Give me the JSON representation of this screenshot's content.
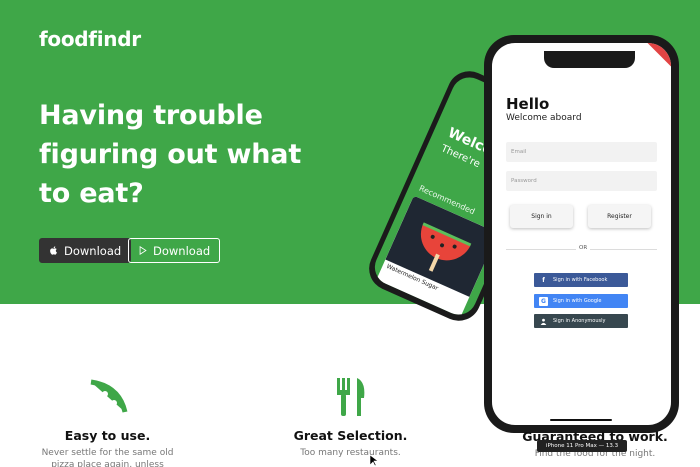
{
  "brand": {
    "name": "foodfindr"
  },
  "hero": {
    "headline_lines": [
      "Having trouble",
      "figuring out what",
      "to eat?"
    ],
    "buttons": [
      {
        "label": "Download",
        "icon": "apple-icon"
      },
      {
        "label": "Download",
        "icon": "play-store-icon"
      }
    ]
  },
  "back_phone": {
    "welcome": "Welco",
    "subtitle": "There're",
    "section": "Recommended",
    "card_name": "Watermelon Sugar"
  },
  "app": {
    "title": "Hello",
    "subtitle": "Welcome aboard",
    "email_placeholder": "Email",
    "password_placeholder": "Password",
    "signin_label": "Sign in",
    "register_label": "Register",
    "divider": "OR",
    "facebook_label": "Sign in with Facebook",
    "google_label": "Sign in with Google",
    "anon_label": "Sign in Anonymously"
  },
  "simulator_label": "iPhone 11 Pro Max — 13.3",
  "features": [
    {
      "title": "Easy to use.",
      "desc": "Never settle for the same old",
      "desc2": "pizza place again, unless",
      "icon": "pizza-icon"
    },
    {
      "title": "Great Selection.",
      "desc": "Too many restaurants.",
      "icon": "fork-knife-icon"
    },
    {
      "title": "Guaranteed to work.",
      "desc": "Find the food for the night.",
      "icon": "check-icon"
    }
  ],
  "colors": {
    "brand_green": "#3fa748",
    "dark_button": "#333333",
    "facebook": "#3b5998",
    "google": "#4285f4",
    "anonymous": "#37474f"
  }
}
